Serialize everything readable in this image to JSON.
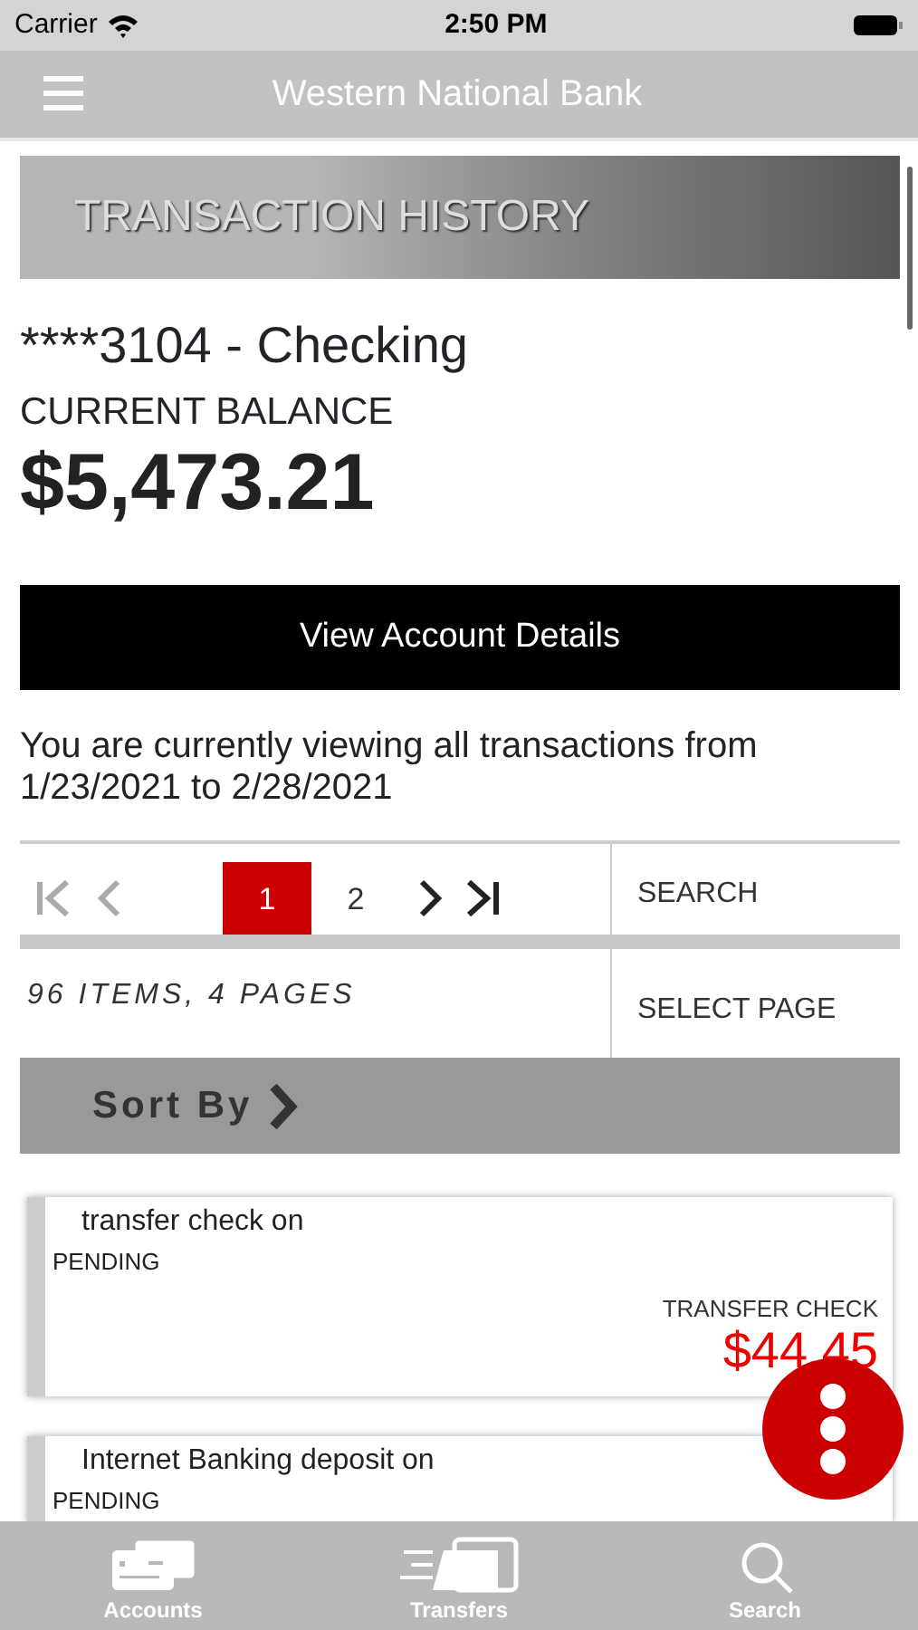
{
  "status_bar": {
    "carrier": "Carrier",
    "time": "2:50 PM"
  },
  "nav": {
    "title": "Western National Bank"
  },
  "header": {
    "title": "TRANSACTION HISTORY"
  },
  "account": {
    "name": "****3104 - Checking",
    "balance_label": "CURRENT BALANCE",
    "balance": "$5,473.21"
  },
  "details_button": "View Account Details",
  "range_text": "You are currently viewing all transactions from 1/23/2021 to 2/28/2021",
  "pager": {
    "nav_buttons": [
      {
        "kind": "first",
        "disabled": true
      },
      {
        "kind": "prev",
        "disabled": true
      },
      {
        "kind": "next",
        "disabled": false
      },
      {
        "kind": "last",
        "disabled": false
      }
    ],
    "pages": [
      {
        "label": "1",
        "selected": true
      },
      {
        "label": "2",
        "selected": false
      }
    ],
    "search": "SEARCH",
    "summary": "96 ITEMS, 4 PAGES",
    "select_page": "SELECT PAGE"
  },
  "sort": {
    "label": "Sort By"
  },
  "transactions": [
    {
      "description": "transfer check on",
      "status": "PENDING",
      "type": "TRANSFER CHECK",
      "amount": "$44.45"
    },
    {
      "description": "Internet Banking deposit on",
      "status": "PENDING"
    }
  ],
  "tabs": [
    {
      "label": "Accounts",
      "kind": "accounts"
    },
    {
      "label": "Transfers",
      "kind": "transfers"
    },
    {
      "label": "Search",
      "kind": "search"
    }
  ]
}
